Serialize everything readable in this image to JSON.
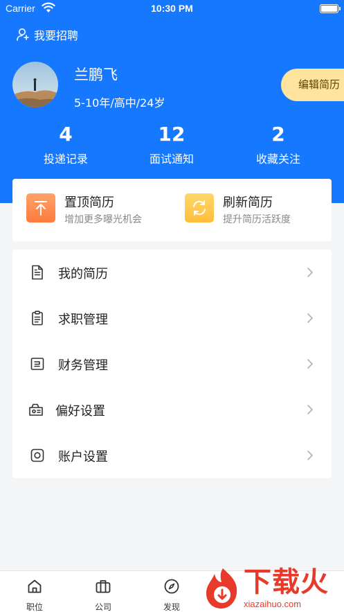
{
  "status_bar": {
    "carrier": "Carrier",
    "time": "10:30 PM"
  },
  "header": {
    "recruit_label": "我要招聘",
    "name": "兰鹏飞",
    "meta": "5-10年/高中/24岁",
    "edit_label": "编辑简历",
    "background_color": "#1677ff"
  },
  "stats": [
    {
      "value": "4",
      "label": "投递记录"
    },
    {
      "value": "12",
      "label": "面试通知"
    },
    {
      "value": "2",
      "label": "收藏关注"
    }
  ],
  "quick_actions": [
    {
      "title": "置顶简历",
      "subtitle": "增加更多曝光机会",
      "icon": "arrow-up-to-top-icon",
      "color": "#ff8a4c"
    },
    {
      "title": "刷新简历",
      "subtitle": "提升简历活跃度",
      "icon": "refresh-icon",
      "color": "#ffc94a"
    }
  ],
  "menu": [
    {
      "label": "我的简历",
      "icon": "document-icon"
    },
    {
      "label": "求职管理",
      "icon": "clipboard-icon"
    },
    {
      "label": "财务管理",
      "icon": "finance-icon"
    },
    {
      "label": "偏好设置",
      "icon": "preferences-icon"
    },
    {
      "label": "账户设置",
      "icon": "account-icon"
    }
  ],
  "tabbar": [
    {
      "label": "职位",
      "icon": "home-icon"
    },
    {
      "label": "公司",
      "icon": "briefcase-icon"
    },
    {
      "label": "发现",
      "icon": "compass-icon"
    }
  ],
  "watermark": {
    "title": "下载火",
    "subtitle": "xiazaihuo.com"
  }
}
